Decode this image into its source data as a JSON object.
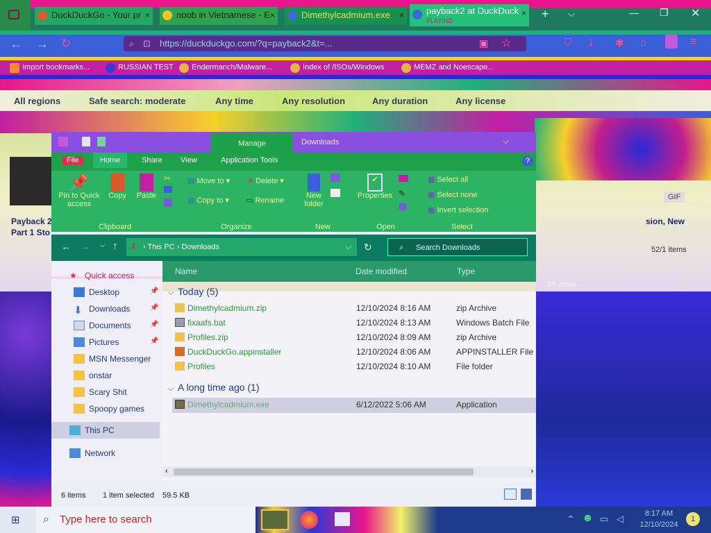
{
  "browser": {
    "tabs": [
      {
        "title": "DuckDuckGo - Your pr",
        "close": "×"
      },
      {
        "title": "noob in Vietnamese - E",
        "close": "×"
      },
      {
        "title": "Dimethylcadmium.exe",
        "close": "×"
      },
      {
        "title": "payback2 at DuckDuck",
        "subtitle": "PLAYING",
        "close": "×"
      }
    ],
    "new_tab": "+",
    "url": "https://duckduckgo.com/?q=payback2&t=...",
    "bookmarks": [
      "Import bookmarks...",
      "RUSSIAN TEST",
      "Endermanch/Malware...",
      "Index of /ISOs/Windows",
      "MEMZ and Noescape..."
    ],
    "filters": [
      "All regions",
      "Safe search: moderate",
      "Any time",
      "Any resolution",
      "Any duration",
      "Any license"
    ],
    "page_fragments": {
      "result_title_line1": "Payback 2",
      "result_title_line2": "Part 1 Sto",
      "right_text": "sion, New",
      "count": "52/1 items",
      "gif_btn": "GIF",
      "views": "18 views"
    }
  },
  "explorer": {
    "title_manage": "Manage",
    "title_folder": "Downloads",
    "ribbon_tabs": [
      "File",
      "Home",
      "Share",
      "View",
      "Application Tools"
    ],
    "ribbon": {
      "pin_label": "Pin to Quick access",
      "copy": "Copy",
      "paste": "Paste",
      "move_to": "Move to",
      "copy_to": "Copy to",
      "delete": "Delete",
      "rename": "Rename",
      "new_folder": "New folder",
      "properties": "Properties",
      "select_all": "Select all",
      "select_none": "Select none",
      "invert_selection": "Invert selection",
      "groups": [
        "Clipboard",
        "Organize",
        "New",
        "Open",
        "Select"
      ]
    },
    "address": [
      "This PC",
      "Downloads"
    ],
    "search_placeholder": "Search Downloads",
    "sidebar": {
      "quick_access": "Quick access",
      "items": [
        "Desktop",
        "Downloads",
        "Documents",
        "Pictures",
        "MSN Messenger",
        "onstar",
        "Scary Shit",
        "Spoopy games"
      ],
      "this_pc": "This PC",
      "network": "Network"
    },
    "columns": [
      "Name",
      "Date modified",
      "Type"
    ],
    "groups": [
      {
        "label": "Today (5)",
        "files": [
          {
            "name": "Dimethylcadmium.zip",
            "date": "12/10/2024 8:16 AM",
            "type": "zip Archive",
            "icon": "zip-folder-icon"
          },
          {
            "name": "fixaafs.bat",
            "date": "12/10/2024 8:13 AM",
            "type": "Windows Batch File",
            "icon": "batch-file-icon"
          },
          {
            "name": "Profiles.zip",
            "date": "12/10/2024 8:09 AM",
            "type": "zip Archive",
            "icon": "zip-folder-icon"
          },
          {
            "name": "DuckDuckGo.appinstaller",
            "date": "12/10/2024 8:06 AM",
            "type": "APPINSTALLER File",
            "icon": "installer-icon"
          },
          {
            "name": "Profiles",
            "date": "12/10/2024 8:10 AM",
            "type": "File folder",
            "icon": "folder-icon"
          }
        ]
      },
      {
        "label": "A long time ago (1)",
        "files": [
          {
            "name": "Dimethylcadmium.exe",
            "date": "6/12/2022 5:06 AM",
            "type": "Application",
            "icon": "exe-icon",
            "selected": true
          }
        ]
      }
    ],
    "status": {
      "items": "6 items",
      "selected": "1 item selected",
      "size": "59.5 KB"
    }
  },
  "taskbar": {
    "search_placeholder": "Type here to search",
    "time": "8:17 AM",
    "date": "12/10/2024",
    "notification_count": "1"
  },
  "colors": {
    "selected_row": "#cfcfe0",
    "file_name": "#2a9a3a",
    "taskbar": "#1e3a8a"
  }
}
